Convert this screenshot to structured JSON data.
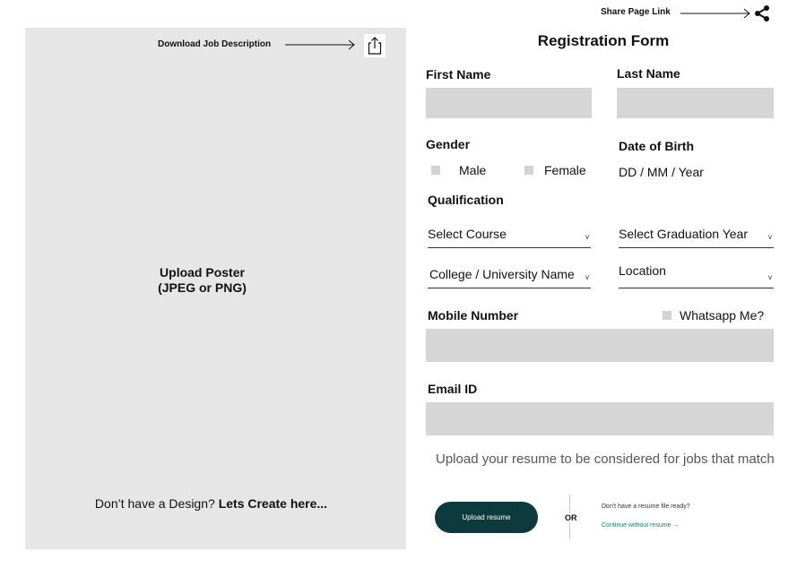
{
  "poster": {
    "download_label": "Download Job Description",
    "download_icon": "share-up-icon",
    "upload_line1": "Upload Poster",
    "upload_line2": "(JPEG or PNG)",
    "no_design_text": "Don’t have a Design? ",
    "create_link": "Lets Create here..."
  },
  "share": {
    "label": "Share Page Link",
    "icon": "share-nodes-icon"
  },
  "form": {
    "title": "Registration Form",
    "first_name_label": "First Name",
    "last_name_label": "Last Name",
    "gender_label": "Gender",
    "gender_options": [
      "Male",
      "Female"
    ],
    "dob_label": "Date of Birth",
    "dob_placeholder": "DD / MM / Year",
    "qualification_label": "Qualification",
    "select_course": "Select Course",
    "select_graduation_year": "Select Graduation Year",
    "college": "College / University Name",
    "location": "Location",
    "caret": "v",
    "mobile_label": "Mobile Number",
    "whatsapp_label": "Whatsapp Me?",
    "email_label": "Email ID"
  },
  "resume": {
    "note": "Upload your resume to be considered for jobs that match",
    "upload_button": "Upload resume",
    "or": "OR",
    "no_file": "Don't have a resume file ready?",
    "continue_link": "Continue without resume →"
  },
  "colors": {
    "panel": "#e6e6e6",
    "field": "#d6d6d6",
    "button": "#0d3b3d",
    "link": "#1a7a6f"
  }
}
